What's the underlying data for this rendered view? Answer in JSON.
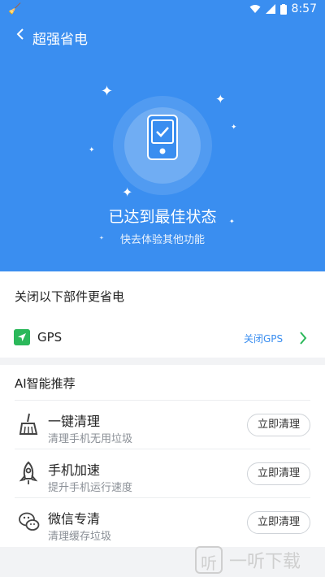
{
  "status_bar": {
    "time": "8:57"
  },
  "header": {
    "title": "超强省电"
  },
  "hero": {
    "state_text": "已达到最佳状态",
    "hint_text": "快去体验其他功能"
  },
  "components": {
    "title": "关闭以下部件更省电",
    "gps": {
      "label": "GPS",
      "action": "关闭GPS"
    }
  },
  "recommend": {
    "title": "AI智能推荐",
    "items": [
      {
        "title": "一键清理",
        "subtitle": "清理手机无用垃圾",
        "button": "立即清理",
        "icon": "broom-icon"
      },
      {
        "title": "手机加速",
        "subtitle": "提升手机运行速度",
        "button": "立即清理",
        "icon": "rocket-icon"
      },
      {
        "title": "微信专清",
        "subtitle": "清理缓存垃圾",
        "button": "立即清理",
        "icon": "wechat-icon"
      }
    ]
  },
  "watermark": {
    "text": "一听下载",
    "glyph": "听"
  },
  "colors": {
    "primary": "#3a8ef0",
    "green": "#2bb85a"
  }
}
